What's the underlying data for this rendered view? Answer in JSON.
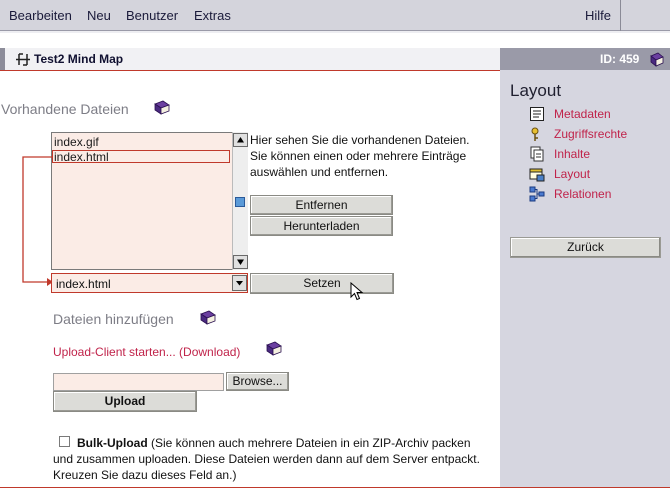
{
  "menu": {
    "bearbeiten": "Bearbeiten",
    "neu": "Neu",
    "benutzer": "Benutzer",
    "extras": "Extras",
    "hilfe": "Hilfe"
  },
  "header": {
    "title": "Test2 Mind Map",
    "id_label": "ID: 459"
  },
  "sidebar": {
    "title": "Layout",
    "items": [
      {
        "label": "Metadaten",
        "icon": "metadata-icon"
      },
      {
        "label": "Zugriffsrechte",
        "icon": "key-icon"
      },
      {
        "label": "Inhalte",
        "icon": "documents-icon"
      },
      {
        "label": "Layout",
        "icon": "layout-icon"
      },
      {
        "label": "Relationen",
        "icon": "relations-icon"
      }
    ],
    "back_label": "Zurück"
  },
  "files": {
    "section_title": "Vorhandene Dateien",
    "list": [
      "index.gif",
      "index.html"
    ],
    "selected_item": "index.html",
    "help_text": "Hier sehen Sie die vorhandenen Dateien. Sie können einen oder mehrere Einträge auswählen und entfernen.",
    "remove_label": "Entfernen",
    "download_label": "Herunterladen",
    "start_file_value": "index.html",
    "set_label": "Setzen"
  },
  "add": {
    "section_title": "Dateien hinzufügen",
    "upload_client_link": "Upload-Client starten... (Download)",
    "browse_label": "Browse...",
    "file_value": "",
    "upload_label": "Upload",
    "bulk_label": "Bulk-Upload",
    "bulk_text": " (Sie können auch mehrere Dateien in ein ZIP-Archiv packen und zusammen uploaden. Diese Dateien werden dann auf dem Server entpackt. Kreuzen Sie dazu dieses Feld an.)",
    "bulk_checked": false
  },
  "colors": {
    "accent": "#c0392b",
    "link": "#c0234a",
    "sidebar_bg": "#d6d6e0",
    "list_bg": "#fbece6"
  }
}
